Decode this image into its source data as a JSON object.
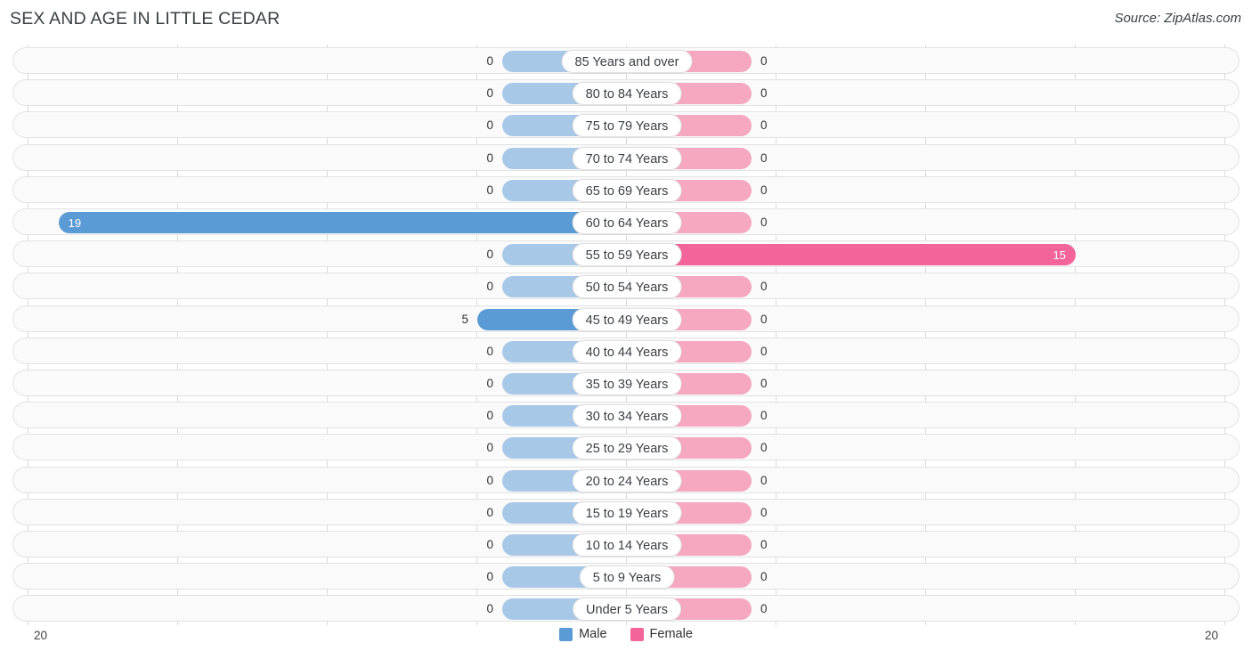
{
  "header": {
    "title": "SEX AND AGE IN LITTLE CEDAR",
    "source": "Source: ZipAtlas.com"
  },
  "legend": {
    "male_label": "Male",
    "female_label": "Female",
    "male_color": "#5b9bd5",
    "female_color": "#f2649a"
  },
  "axis": {
    "left_max": "20",
    "right_max": "20"
  },
  "colors": {
    "male_bar": "#5b9bd5",
    "male_zero_bar": "#a8c8e8",
    "female_bar": "#f2649a",
    "female_zero_bar": "#f5a8c0",
    "row_track": "#fafafa",
    "row_border": "#e2e2e2",
    "gridline": "#d9d9d9"
  },
  "chart_data": {
    "type": "bar",
    "title": "SEX AND AGE IN LITTLE CEDAR",
    "subtitle": "",
    "xlabel": "",
    "ylabel": "",
    "orientation": "horizontal",
    "layout": "population-pyramid",
    "xlim": [
      20,
      20
    ],
    "grid": true,
    "legend_position": "bottom-center",
    "categories": [
      "85 Years and over",
      "80 to 84 Years",
      "75 to 79 Years",
      "70 to 74 Years",
      "65 to 69 Years",
      "60 to 64 Years",
      "55 to 59 Years",
      "50 to 54 Years",
      "45 to 49 Years",
      "40 to 44 Years",
      "35 to 39 Years",
      "30 to 34 Years",
      "25 to 29 Years",
      "20 to 24 Years",
      "15 to 19 Years",
      "10 to 14 Years",
      "5 to 9 Years",
      "Under 5 Years"
    ],
    "series": [
      {
        "name": "Male",
        "values": [
          0,
          0,
          0,
          0,
          0,
          19,
          0,
          0,
          5,
          0,
          0,
          0,
          0,
          0,
          0,
          0,
          0,
          0
        ]
      },
      {
        "name": "Female",
        "values": [
          0,
          0,
          0,
          0,
          0,
          0,
          15,
          0,
          0,
          0,
          0,
          0,
          0,
          0,
          0,
          0,
          0,
          0
        ]
      }
    ]
  },
  "rows": [
    {
      "label": "85 Years and over",
      "male": "0",
      "female": "0"
    },
    {
      "label": "80 to 84 Years",
      "male": "0",
      "female": "0"
    },
    {
      "label": "75 to 79 Years",
      "male": "0",
      "female": "0"
    },
    {
      "label": "70 to 74 Years",
      "male": "0",
      "female": "0"
    },
    {
      "label": "65 to 69 Years",
      "male": "0",
      "female": "0"
    },
    {
      "label": "60 to 64 Years",
      "male": "19",
      "female": "0"
    },
    {
      "label": "55 to 59 Years",
      "male": "0",
      "female": "15"
    },
    {
      "label": "50 to 54 Years",
      "male": "0",
      "female": "0"
    },
    {
      "label": "45 to 49 Years",
      "male": "5",
      "female": "0"
    },
    {
      "label": "40 to 44 Years",
      "male": "0",
      "female": "0"
    },
    {
      "label": "35 to 39 Years",
      "male": "0",
      "female": "0"
    },
    {
      "label": "30 to 34 Years",
      "male": "0",
      "female": "0"
    },
    {
      "label": "25 to 29 Years",
      "male": "0",
      "female": "0"
    },
    {
      "label": "20 to 24 Years",
      "male": "0",
      "female": "0"
    },
    {
      "label": "15 to 19 Years",
      "male": "0",
      "female": "0"
    },
    {
      "label": "10 to 14 Years",
      "male": "0",
      "female": "0"
    },
    {
      "label": "5 to 9 Years",
      "male": "0",
      "female": "0"
    },
    {
      "label": "Under 5 Years",
      "male": "0",
      "female": "0"
    }
  ]
}
